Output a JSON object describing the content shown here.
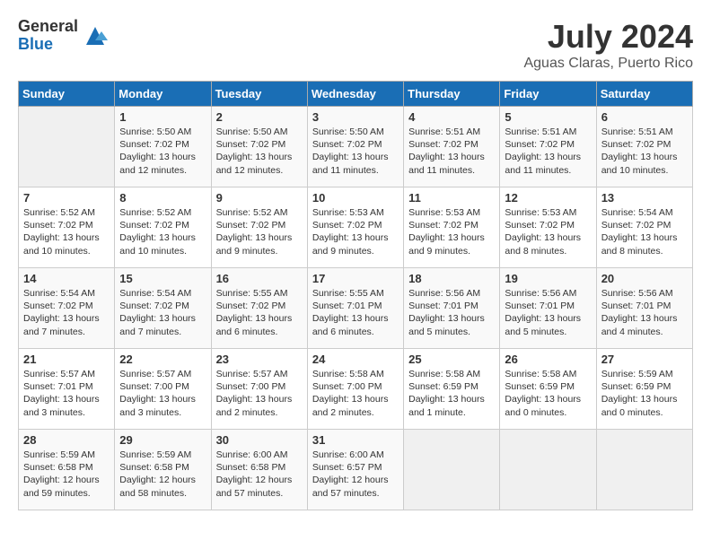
{
  "logo": {
    "general": "General",
    "blue": "Blue"
  },
  "title": "July 2024",
  "location": "Aguas Claras, Puerto Rico",
  "days_of_week": [
    "Sunday",
    "Monday",
    "Tuesday",
    "Wednesday",
    "Thursday",
    "Friday",
    "Saturday"
  ],
  "weeks": [
    [
      {
        "day": "",
        "info": ""
      },
      {
        "day": "1",
        "info": "Sunrise: 5:50 AM\nSunset: 7:02 PM\nDaylight: 13 hours\nand 12 minutes."
      },
      {
        "day": "2",
        "info": "Sunrise: 5:50 AM\nSunset: 7:02 PM\nDaylight: 13 hours\nand 12 minutes."
      },
      {
        "day": "3",
        "info": "Sunrise: 5:50 AM\nSunset: 7:02 PM\nDaylight: 13 hours\nand 11 minutes."
      },
      {
        "day": "4",
        "info": "Sunrise: 5:51 AM\nSunset: 7:02 PM\nDaylight: 13 hours\nand 11 minutes."
      },
      {
        "day": "5",
        "info": "Sunrise: 5:51 AM\nSunset: 7:02 PM\nDaylight: 13 hours\nand 11 minutes."
      },
      {
        "day": "6",
        "info": "Sunrise: 5:51 AM\nSunset: 7:02 PM\nDaylight: 13 hours\nand 10 minutes."
      }
    ],
    [
      {
        "day": "7",
        "info": "Sunrise: 5:52 AM\nSunset: 7:02 PM\nDaylight: 13 hours\nand 10 minutes."
      },
      {
        "day": "8",
        "info": "Sunrise: 5:52 AM\nSunset: 7:02 PM\nDaylight: 13 hours\nand 10 minutes."
      },
      {
        "day": "9",
        "info": "Sunrise: 5:52 AM\nSunset: 7:02 PM\nDaylight: 13 hours\nand 9 minutes."
      },
      {
        "day": "10",
        "info": "Sunrise: 5:53 AM\nSunset: 7:02 PM\nDaylight: 13 hours\nand 9 minutes."
      },
      {
        "day": "11",
        "info": "Sunrise: 5:53 AM\nSunset: 7:02 PM\nDaylight: 13 hours\nand 9 minutes."
      },
      {
        "day": "12",
        "info": "Sunrise: 5:53 AM\nSunset: 7:02 PM\nDaylight: 13 hours\nand 8 minutes."
      },
      {
        "day": "13",
        "info": "Sunrise: 5:54 AM\nSunset: 7:02 PM\nDaylight: 13 hours\nand 8 minutes."
      }
    ],
    [
      {
        "day": "14",
        "info": "Sunrise: 5:54 AM\nSunset: 7:02 PM\nDaylight: 13 hours\nand 7 minutes."
      },
      {
        "day": "15",
        "info": "Sunrise: 5:54 AM\nSunset: 7:02 PM\nDaylight: 13 hours\nand 7 minutes."
      },
      {
        "day": "16",
        "info": "Sunrise: 5:55 AM\nSunset: 7:02 PM\nDaylight: 13 hours\nand 6 minutes."
      },
      {
        "day": "17",
        "info": "Sunrise: 5:55 AM\nSunset: 7:01 PM\nDaylight: 13 hours\nand 6 minutes."
      },
      {
        "day": "18",
        "info": "Sunrise: 5:56 AM\nSunset: 7:01 PM\nDaylight: 13 hours\nand 5 minutes."
      },
      {
        "day": "19",
        "info": "Sunrise: 5:56 AM\nSunset: 7:01 PM\nDaylight: 13 hours\nand 5 minutes."
      },
      {
        "day": "20",
        "info": "Sunrise: 5:56 AM\nSunset: 7:01 PM\nDaylight: 13 hours\nand 4 minutes."
      }
    ],
    [
      {
        "day": "21",
        "info": "Sunrise: 5:57 AM\nSunset: 7:01 PM\nDaylight: 13 hours\nand 3 minutes."
      },
      {
        "day": "22",
        "info": "Sunrise: 5:57 AM\nSunset: 7:00 PM\nDaylight: 13 hours\nand 3 minutes."
      },
      {
        "day": "23",
        "info": "Sunrise: 5:57 AM\nSunset: 7:00 PM\nDaylight: 13 hours\nand 2 minutes."
      },
      {
        "day": "24",
        "info": "Sunrise: 5:58 AM\nSunset: 7:00 PM\nDaylight: 13 hours\nand 2 minutes."
      },
      {
        "day": "25",
        "info": "Sunrise: 5:58 AM\nSunset: 6:59 PM\nDaylight: 13 hours\nand 1 minute."
      },
      {
        "day": "26",
        "info": "Sunrise: 5:58 AM\nSunset: 6:59 PM\nDaylight: 13 hours\nand 0 minutes."
      },
      {
        "day": "27",
        "info": "Sunrise: 5:59 AM\nSunset: 6:59 PM\nDaylight: 13 hours\nand 0 minutes."
      }
    ],
    [
      {
        "day": "28",
        "info": "Sunrise: 5:59 AM\nSunset: 6:58 PM\nDaylight: 12 hours\nand 59 minutes."
      },
      {
        "day": "29",
        "info": "Sunrise: 5:59 AM\nSunset: 6:58 PM\nDaylight: 12 hours\nand 58 minutes."
      },
      {
        "day": "30",
        "info": "Sunrise: 6:00 AM\nSunset: 6:58 PM\nDaylight: 12 hours\nand 57 minutes."
      },
      {
        "day": "31",
        "info": "Sunrise: 6:00 AM\nSunset: 6:57 PM\nDaylight: 12 hours\nand 57 minutes."
      },
      {
        "day": "",
        "info": ""
      },
      {
        "day": "",
        "info": ""
      },
      {
        "day": "",
        "info": ""
      }
    ]
  ]
}
